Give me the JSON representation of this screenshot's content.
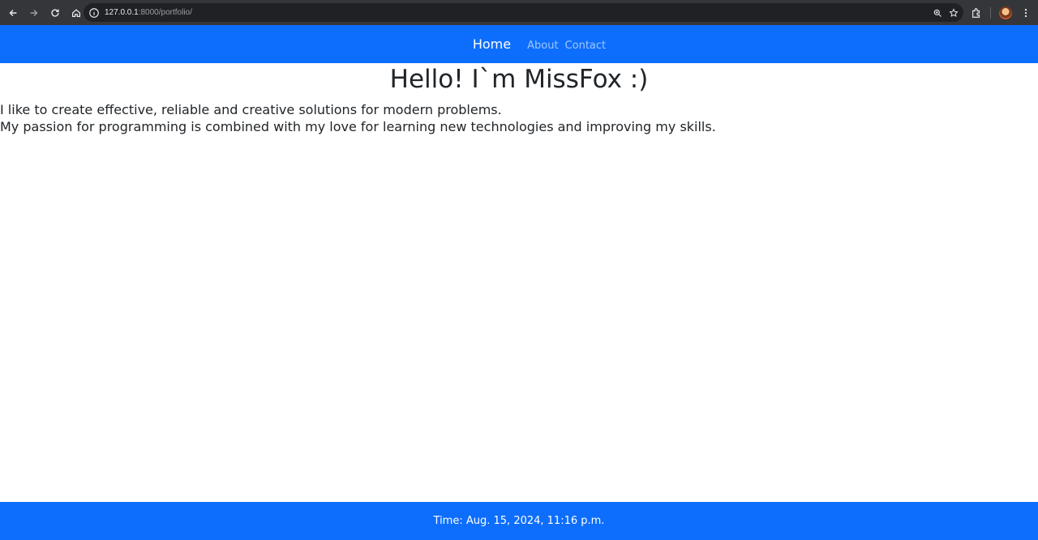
{
  "browser": {
    "url_host": "127.0.0.1",
    "url_rest": ":8000/portfolio/"
  },
  "navbar": {
    "home_label": "Home",
    "about_label": "About",
    "contact_label": "Contact",
    "color": "#0d6efd"
  },
  "main": {
    "title": "Hello! I`m MissFox :)",
    "lines": [
      "I like to create effective, reliable and creative solutions for modern problems.",
      "My passion for programming is combined with my love for learning new technologies and improving my skills."
    ]
  },
  "footer": {
    "text": "Time: Aug. 15, 2024, 11:16 p.m."
  }
}
